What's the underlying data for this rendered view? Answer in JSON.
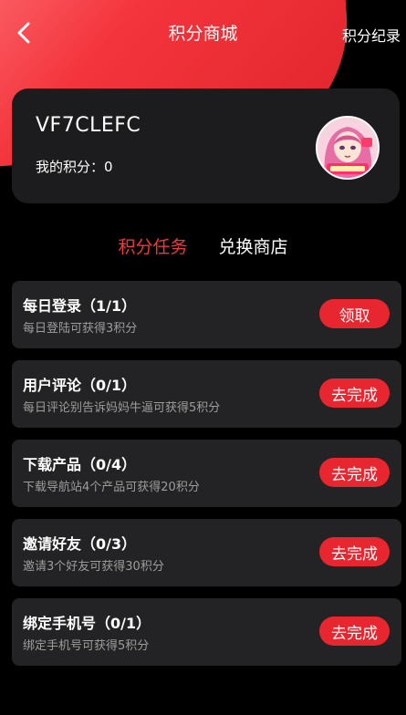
{
  "header": {
    "title": "积分商城",
    "records_label": "积分纪录"
  },
  "profile": {
    "user_id": "VF7CLEFC",
    "points_label": "我的积分：",
    "points_value": "0"
  },
  "tabs": [
    {
      "label": "积分任务",
      "active": true
    },
    {
      "label": "兑换商店",
      "active": false
    }
  ],
  "tasks": [
    {
      "title": "每日登录（1/1）",
      "desc": "每日登陆可获得3积分",
      "button": "领取"
    },
    {
      "title": "用户评论（0/1）",
      "desc": "每日评论别告诉妈妈牛逼可获得5积分",
      "button": "去完成"
    },
    {
      "title": "下载产品（0/4）",
      "desc": "下载导航站4个产品可获得20积分",
      "button": "去完成"
    },
    {
      "title": "邀请好友（0/3）",
      "desc": "邀请3个好友可获得30积分",
      "button": "去完成"
    },
    {
      "title": "绑定手机号（0/1）",
      "desc": "绑定手机号可获得5积分",
      "button": "去完成"
    }
  ],
  "colors": {
    "accent": "#e8262f",
    "active_tab": "#f0373d",
    "card_bg": "#1c1c1e",
    "task_bg": "#232325"
  },
  "icons": [
    "back-arrow-icon"
  ]
}
